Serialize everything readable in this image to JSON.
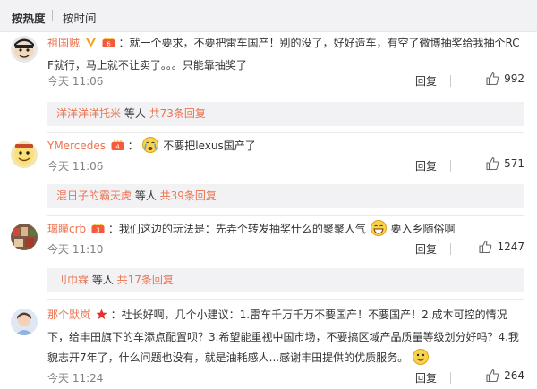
{
  "sort": {
    "hot_label": "按热度",
    "time_label": "按时间"
  },
  "comments": [
    {
      "user": "祖国贼",
      "text_before": "：就一个要求，不要把雷车国产！别的没了，好好造车，有空了微博抽奖给我抽个RC F就行，马上就不让卖了。。。只能靠抽奖了",
      "time": "今天 11:06",
      "reply_label": "回复",
      "likes": "992",
      "sub": {
        "who": "洋洋洋洋托米",
        "mid": " 等人 ",
        "more": "共73条回复"
      }
    },
    {
      "user": "YMercedes",
      "text": "不要把lexus国产了",
      "time": "今天 11:06",
      "reply_label": "回复",
      "likes": "571",
      "sub": {
        "who": "混日子的霸天虎",
        "mid": " 等人 ",
        "more": "共39条回复"
      }
    },
    {
      "user": "璃瞳crb",
      "text_before": "：我们这边的玩法是：先弄个转发抽奖什么的聚聚人气",
      "text_after": "要入乡随俗啊",
      "time": "今天 11:10",
      "reply_label": "回复",
      "likes": "1247",
      "sub": {
        "who": "刂巾霖",
        "mid": " 等人 ",
        "more": "共17条回复"
      }
    },
    {
      "user": "那个默岚",
      "text_before": "：社长好啊，几个小建议：1.雷车千万千万不要国产！不要国产！2.成本可控的情况下，给丰田旗下的车添点配置呗？3.希望能重视中国市场，不要搞区域产品质量等级划分好吗？4.我貌志开7年了，什么问题也没有，就是油耗感人...感谢丰田提供的优质服务。",
      "time": "今天 11:24",
      "reply_label": "回复",
      "likes": "264"
    }
  ],
  "colors": {
    "username": "#eb7350",
    "panel_bg": "#f2f2f5",
    "meta_gray": "#808080"
  }
}
